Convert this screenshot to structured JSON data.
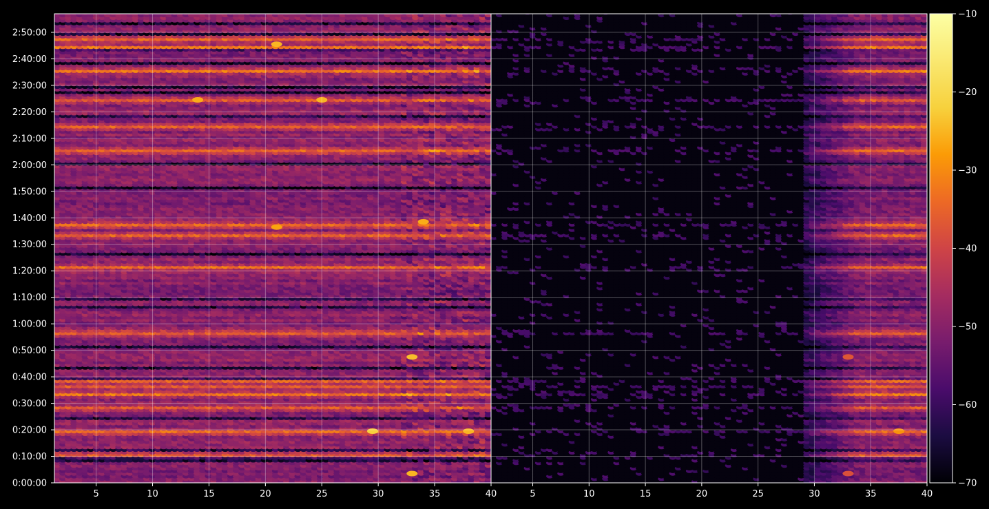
{
  "chart_data": {
    "type": "heatmap",
    "title": "",
    "colormap": "inferno",
    "background": "#000000",
    "grid": true,
    "y_axis": {
      "label": "",
      "ticks": [
        "0:00:00",
        "0:10:00",
        "0:20:00",
        "0:30:00",
        "0:40:00",
        "0:50:00",
        "1:00:00",
        "1:10:00",
        "1:20:00",
        "1:30:00",
        "1:40:00",
        "1:50:00",
        "2:00:00",
        "2:10:00",
        "2:20:00",
        "2:30:00",
        "2:40:00",
        "2:50:00"
      ],
      "range_minutes": [
        0,
        177
      ]
    },
    "panels": [
      {
        "name": "left",
        "x_range": [
          1.3,
          40
        ],
        "x_ticks": [
          "5",
          "10",
          "15",
          "20",
          "25",
          "30",
          "35",
          "40"
        ],
        "description_level": "active across all x"
      },
      {
        "name": "right",
        "x_range": [
          1.3,
          40
        ],
        "x_ticks": [
          "5",
          "10",
          "15",
          "20",
          "25",
          "30",
          "35",
          "40"
        ],
        "description_level": "active mainly x>=30"
      }
    ],
    "colorbar": {
      "min": -70,
      "max": -10,
      "ticks": [
        "−10",
        "−20",
        "−30",
        "−40",
        "−50",
        "−60",
        "−70"
      ]
    },
    "bright_rows_minutes": [
      10,
      19,
      28,
      33,
      36,
      38,
      56,
      81,
      93,
      97,
      125,
      134,
      144,
      155,
      164,
      167
    ],
    "hotspots": [
      {
        "panel": "left",
        "x": 33,
        "t": 3,
        "v": -25
      },
      {
        "panel": "left",
        "x": 29.5,
        "t": 19,
        "v": -22
      },
      {
        "panel": "left",
        "x": 33,
        "t": 47,
        "v": -24
      },
      {
        "panel": "left",
        "x": 34,
        "t": 98,
        "v": -26
      },
      {
        "panel": "left",
        "x": 21,
        "t": 96,
        "v": -27
      },
      {
        "panel": "left",
        "x": 14,
        "t": 144,
        "v": -26
      },
      {
        "panel": "left",
        "x": 25,
        "t": 144,
        "v": -25
      },
      {
        "panel": "left",
        "x": 21,
        "t": 165,
        "v": -25
      },
      {
        "panel": "left",
        "x": 38,
        "t": 19,
        "v": -25
      },
      {
        "panel": "right",
        "x": 37.5,
        "t": 19,
        "v": -29
      },
      {
        "panel": "right",
        "x": 33,
        "t": 3,
        "v": -38
      },
      {
        "panel": "right",
        "x": 33,
        "t": 47,
        "v": -37
      }
    ]
  }
}
